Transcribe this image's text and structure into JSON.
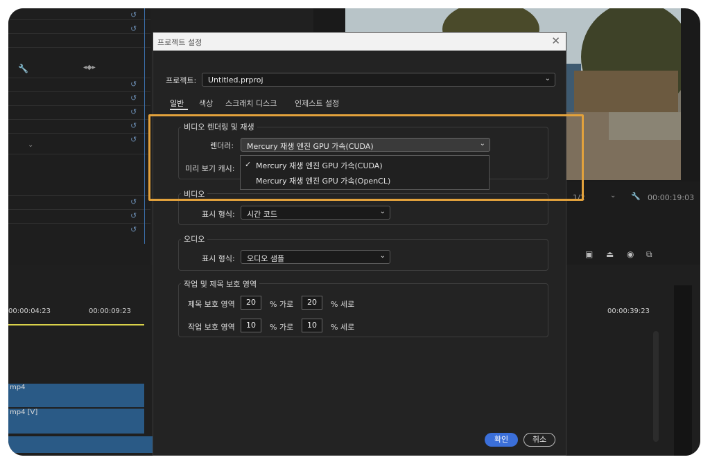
{
  "dialog": {
    "title": "프로젝트 설정",
    "close_label": "✕",
    "project_label": "프로젝트:",
    "project_value": "Untitled.prproj",
    "tabs": [
      {
        "label": "일반"
      },
      {
        "label": "색상"
      },
      {
        "label": "스크래치 디스크"
      },
      {
        "label": "인제스트 설정"
      }
    ],
    "video_render": {
      "title": "비디오 렌더링 및 재생",
      "renderer_label": "렌더러:",
      "renderer_value": "Mercury 재생 엔진 GPU 가속(CUDA)",
      "preview_cache_label": "미리 보기 캐시:",
      "dropdown_options": [
        {
          "label": "Mercury 재생 엔진 GPU 가속(CUDA)",
          "checked": true
        },
        {
          "label": "Mercury 재생 엔진 GPU 가속(OpenCL)",
          "checked": false
        }
      ]
    },
    "video": {
      "title": "비디오",
      "display_format_label": "표시 형식:",
      "display_format_value": "시간 코드"
    },
    "audio": {
      "title": "오디오",
      "display_format_label": "표시 형식:",
      "display_format_value": "오디오 샘플"
    },
    "safe_areas": {
      "title": "작업 및 제목 보호 영역",
      "title_safe_label": "제목 보호 영역",
      "title_h": "20",
      "title_v": "20",
      "action_safe_label": "작업 보호 영역",
      "action_h": "10",
      "action_v": "10",
      "h_unit": "% 가로",
      "v_unit": "% 세로"
    },
    "ok_label": "확인",
    "cancel_label": "취소"
  },
  "timeline": {
    "time_a": "00:00:04:23",
    "time_b": "00:00:09:23",
    "time_c": "00:00:39:23",
    "program_time": "00:00:19:03",
    "zoom": "1/2",
    "clip_1": "mp4",
    "clip_2": "mp4 [V]"
  },
  "colors": {
    "highlight": "#e3a23c",
    "ok_button": "#3b6fd9",
    "clip": "#2a5a86"
  }
}
